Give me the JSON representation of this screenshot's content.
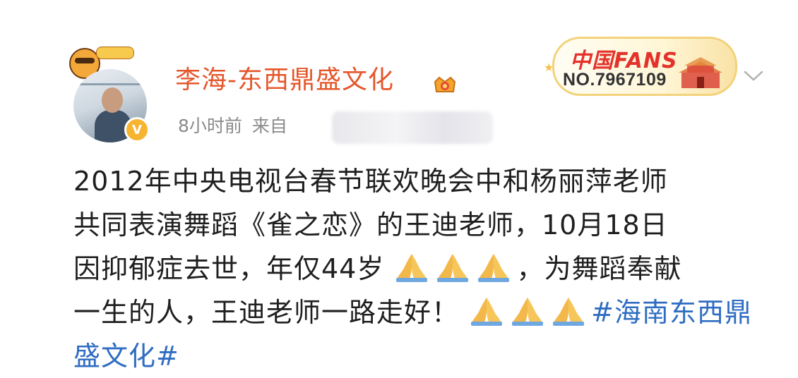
{
  "post": {
    "username": "李海-东西鼎盛文化",
    "time": "8小时前",
    "source_label": "来自",
    "fans_badge": {
      "title": "中国FANS",
      "number": "NO.7967109"
    },
    "text_parts": {
      "line1": "2012年中央电视台春节联欢晚会中和杨丽萍老师",
      "line2": "共同表演舞蹈《雀之恋》的王迪老师，10月18日",
      "line3a": "因抑郁症去世，年仅44岁",
      "line3b": "，为舞蹈奉献",
      "line4a": "一生的人，王迪老师一路走好！",
      "hashtag": "#海南东西鼎盛文化#"
    },
    "emoji": "folded-hands",
    "colors": {
      "username": "#e5572b",
      "hashtag": "#2f6dc2",
      "meta": "#8a8a8a"
    }
  }
}
